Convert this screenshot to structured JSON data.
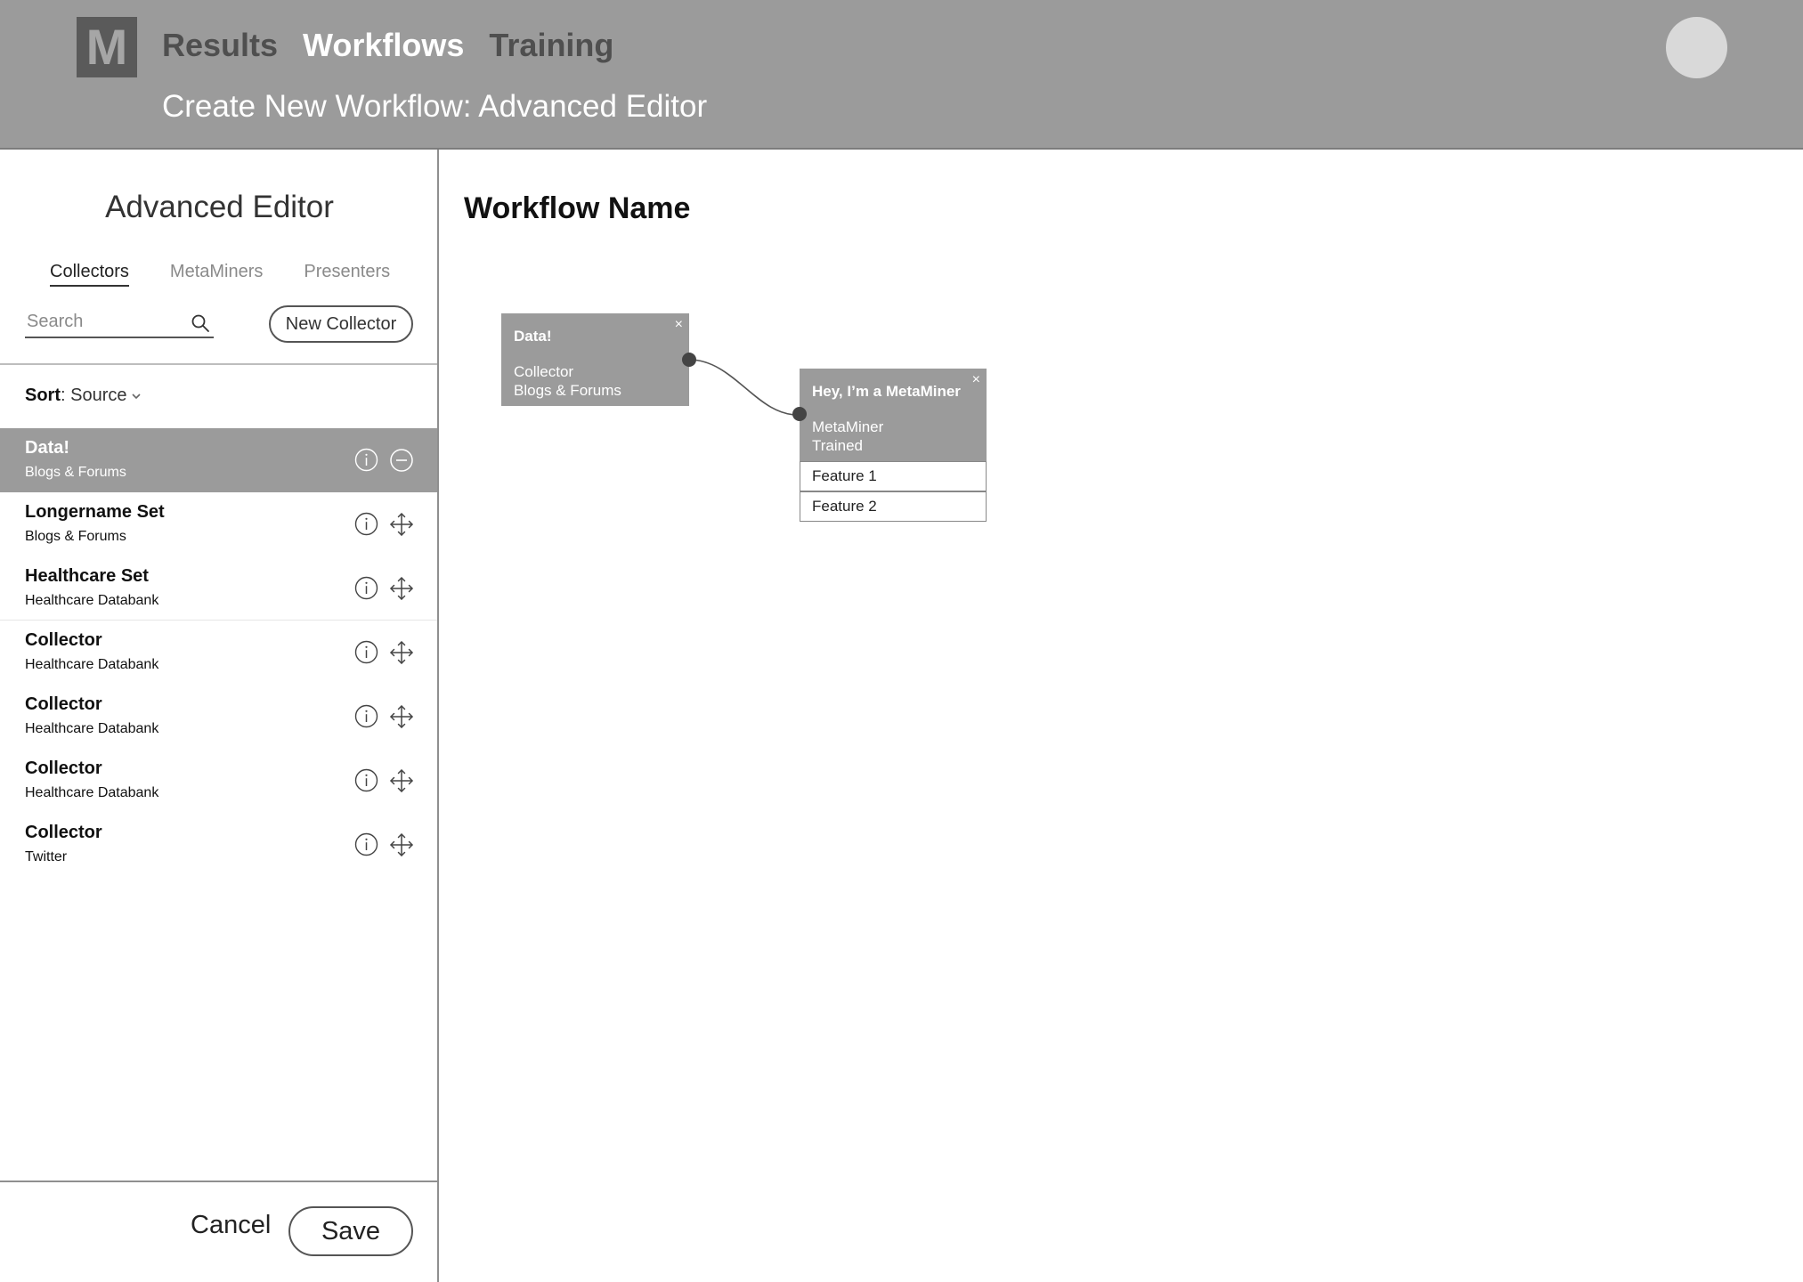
{
  "header": {
    "logo_letter": "M",
    "nav": [
      "Results",
      "Workflows",
      "Training"
    ],
    "subtitle": "Create New Workflow: Advanced Editor"
  },
  "sidebar": {
    "title": "Advanced Editor",
    "tabs": [
      "Collectors",
      "MetaMiners",
      "Presenters"
    ],
    "search_placeholder": "Search",
    "new_button": "New Collector",
    "sort_label": "Sort",
    "sort_value": ": Source",
    "items": [
      {
        "name": "Data!",
        "sub": "Blogs & Forums"
      },
      {
        "name": "Longername Set",
        "sub": "Blogs & Forums"
      },
      {
        "name": "Healthcare Set",
        "sub": "Healthcare Databank"
      },
      {
        "name": "Collector",
        "sub": "Healthcare Databank"
      },
      {
        "name": "Collector",
        "sub": "Healthcare Databank"
      },
      {
        "name": "Collector",
        "sub": "Healthcare Databank"
      },
      {
        "name": "Collector",
        "sub": "Twitter"
      }
    ],
    "cancel": "Cancel",
    "save": "Save"
  },
  "canvas": {
    "workflow_name": "Workflow Name",
    "nodes": {
      "collector": {
        "title": "Data!",
        "line1": "Collector",
        "line2": "Blogs & Forums",
        "close": "×"
      },
      "metaminer": {
        "title": "Hey, I’m a MetaMiner",
        "line1": "MetaMiner",
        "line2": "Trained",
        "close": "×",
        "features": [
          "Feature 1",
          "Feature 2"
        ]
      }
    }
  },
  "colors": {
    "header_bg": "#9b9b9b",
    "logo_bg": "#5a5a5a",
    "selected_bg": "#9b9b9b",
    "port": "#444444"
  }
}
